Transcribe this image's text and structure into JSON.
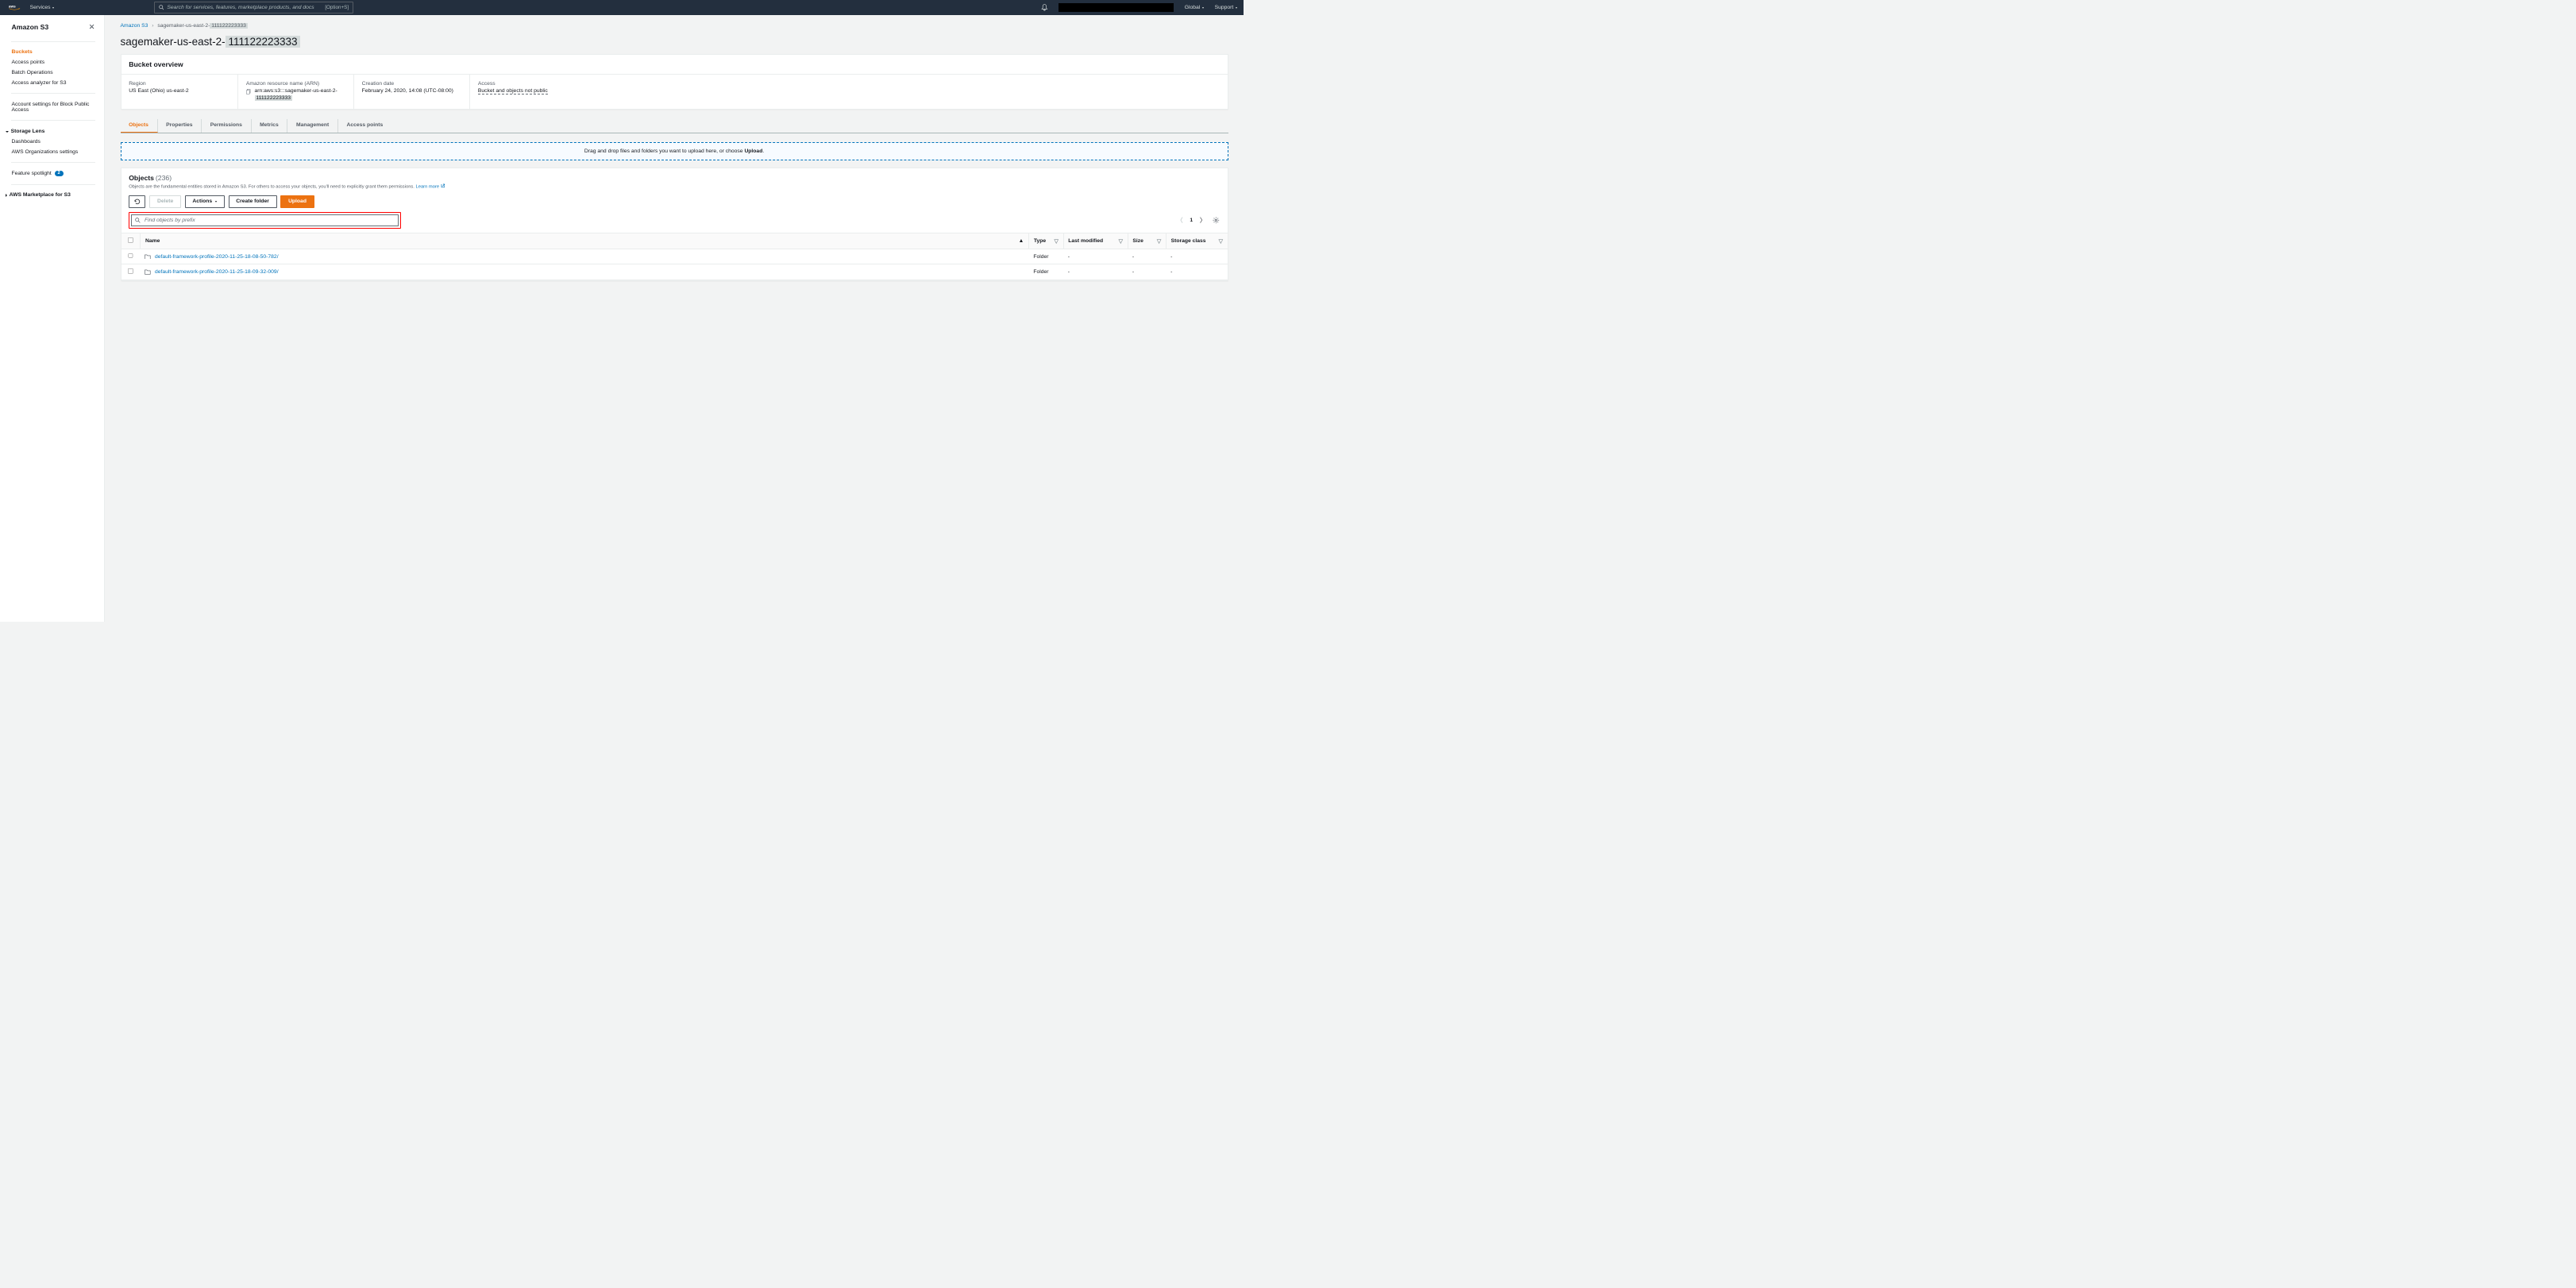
{
  "topnav": {
    "services": "Services",
    "search_placeholder": "Search for services, features, marketplace products, and docs",
    "search_shortcut": "[Option+S]",
    "global": "Global",
    "support": "Support"
  },
  "sidebar": {
    "title": "Amazon S3",
    "items": {
      "buckets": "Buckets",
      "access_points": "Access points",
      "batch_ops": "Batch Operations",
      "access_analyzer": "Access analyzer for S3",
      "account_settings": "Account settings for Block Public Access",
      "storage_lens": "Storage Lens",
      "dashboards": "Dashboards",
      "org_settings": "AWS Organizations settings",
      "feature_spotlight": "Feature spotlight",
      "feature_badge": "2",
      "marketplace": "AWS Marketplace for S3"
    }
  },
  "breadcrumb": {
    "root": "Amazon S3",
    "bucket_prefix": "sagemaker-us-east-2-",
    "bucket_suffix": "111122223333"
  },
  "title": {
    "prefix": "sagemaker-us-east-2-",
    "suffix": "111122223333"
  },
  "overview": {
    "header": "Bucket overview",
    "region_label": "Region",
    "region_value": "US East (Ohio) us-east-2",
    "arn_label": "Amazon resource name (ARN)",
    "arn_value_prefix": "arn:aws:s3:::sagemaker-us-east-2-",
    "arn_value_suffix": "111122223333",
    "creation_label": "Creation date",
    "creation_value": "February 24, 2020, 14:08 (UTC-08:00)",
    "access_label": "Access",
    "access_value": "Bucket and objects not public"
  },
  "tabs": {
    "objects": "Objects",
    "properties": "Properties",
    "permissions": "Permissions",
    "metrics": "Metrics",
    "management": "Management",
    "access_points": "Access points"
  },
  "dropzone": {
    "text_a": "Drag and drop files and folders you want to upload here, or choose ",
    "text_b": "Upload",
    "text_c": "."
  },
  "objects": {
    "title": "Objects",
    "count": "(236)",
    "desc": "Objects are the fundamental entities stored in Amazon S3. For others to access your objects, you'll need to explicitly grant them permissions. ",
    "learn_more": "Learn more",
    "delete": "Delete",
    "actions": "Actions",
    "create_folder": "Create folder",
    "upload": "Upload",
    "filter_placeholder": "Find objects by prefix",
    "page": "1",
    "cols": {
      "name": "Name",
      "type": "Type",
      "last_modified": "Last modified",
      "size": "Size",
      "storage_class": "Storage class"
    },
    "rows": [
      {
        "name": "default-framework-profile-2020-11-25-18-08-50-782/",
        "type": "Folder",
        "lm": "-",
        "size": "-",
        "sc": "-"
      },
      {
        "name": "default-framework-profile-2020-11-25-18-09-32-009/",
        "type": "Folder",
        "lm": "-",
        "size": "-",
        "sc": "-"
      }
    ]
  }
}
